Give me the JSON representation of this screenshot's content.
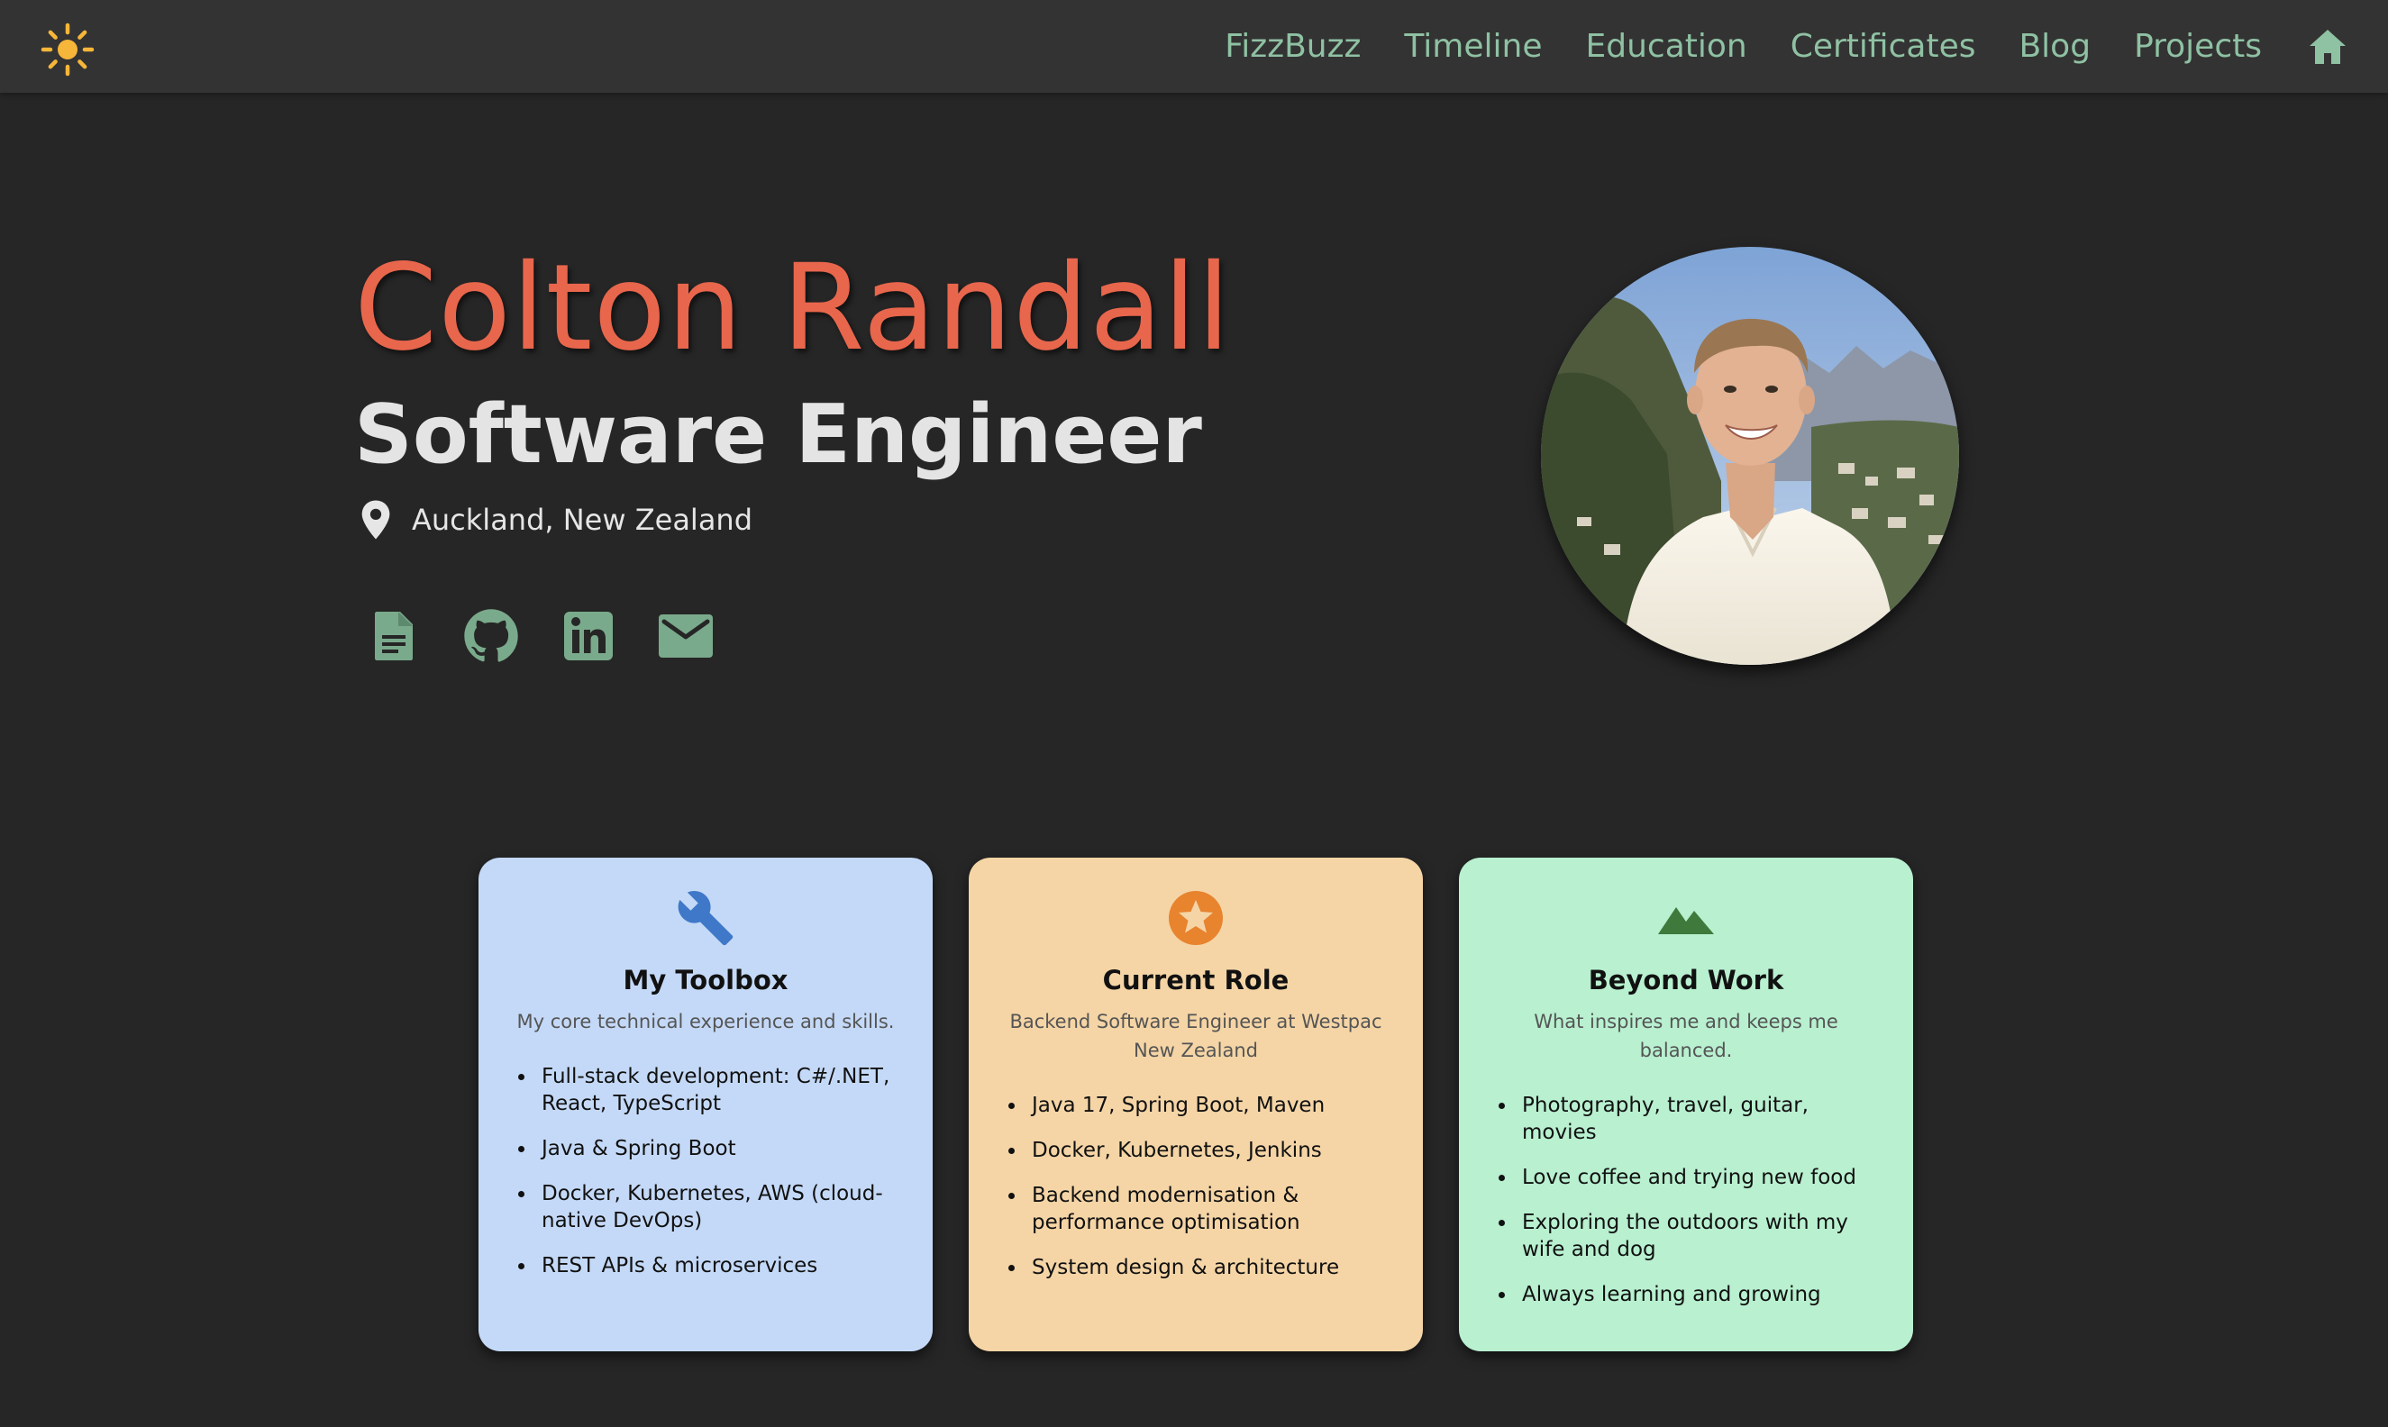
{
  "header": {
    "theme_toggle_icon": "sun-icon",
    "nav": [
      {
        "label": "FizzBuzz"
      },
      {
        "label": "Timeline"
      },
      {
        "label": "Education"
      },
      {
        "label": "Certificates"
      },
      {
        "label": "Blog"
      },
      {
        "label": "Projects"
      }
    ],
    "home_icon": "home-icon"
  },
  "hero": {
    "name": "Colton Randall",
    "title": "Software Engineer",
    "location": "Auckland, New Zealand",
    "socials": [
      {
        "icon": "document-icon"
      },
      {
        "icon": "github-icon"
      },
      {
        "icon": "linkedin-icon"
      },
      {
        "icon": "email-icon"
      }
    ],
    "photo": "profile-photo"
  },
  "cards": [
    {
      "icon": "wrench-icon",
      "title": "My Toolbox",
      "description": "My core technical experience and skills.",
      "items": [
        "Full-stack development: C#/.NET, React, TypeScript",
        "Java & Spring Boot",
        "Docker, Kubernetes, AWS (cloud-native DevOps)",
        "REST APIs & microservices"
      ]
    },
    {
      "icon": "star-badge-icon",
      "title": "Current Role",
      "description": "Backend Software Engineer at Westpac New Zealand",
      "items": [
        "Java 17, Spring Boot, Maven",
        "Docker, Kubernetes, Jenkins",
        "Backend modernisation & performance optimisation",
        "System design & architecture"
      ]
    },
    {
      "icon": "mountain-icon",
      "title": "Beyond Work",
      "description": "What inspires me and keeps me balanced.",
      "items": [
        "Photography, travel, guitar, movies",
        "Love coffee and trying new food",
        "Exploring the outdoors with my wife and dog",
        "Always learning and growing"
      ]
    }
  ],
  "colors": {
    "background": "#262626",
    "topbar": "#333333",
    "nav_link": "#8fc1a3",
    "name_accent": "#e8664c",
    "card_toolbox": "#c4d9f7",
    "card_role": "#f5d5a6",
    "card_beyond": "#b8f0d0"
  }
}
